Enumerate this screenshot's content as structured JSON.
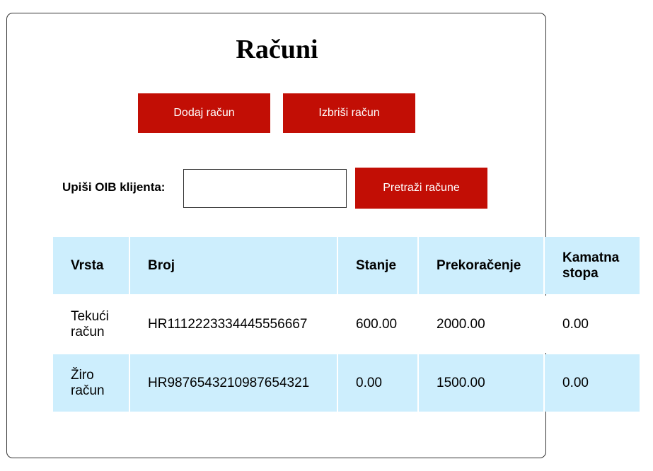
{
  "page": {
    "title": "Računi"
  },
  "toolbar": {
    "add_label": "Dodaj račun",
    "delete_label": "Izbriši račun"
  },
  "search": {
    "label": "Upiši OIB klijenta:",
    "value": "",
    "placeholder": "",
    "button_label": "Pretraži račune"
  },
  "table": {
    "headers": [
      "Vrsta",
      "Broj",
      "Stanje",
      "Prekoračenje",
      "Kamatna stopa"
    ],
    "rows": [
      [
        "Tekući račun",
        "HR1112223334445556667",
        "600.00",
        "2000.00",
        "0.00"
      ],
      [
        "Žiro račun",
        "HR9876543210987654321",
        "0.00",
        "1500.00",
        "0.00"
      ]
    ]
  },
  "colors": {
    "button_bg": "#c20e05",
    "button_text": "#ffffff",
    "table_highlight": "#cdeefd",
    "panel_border": "#333333"
  }
}
